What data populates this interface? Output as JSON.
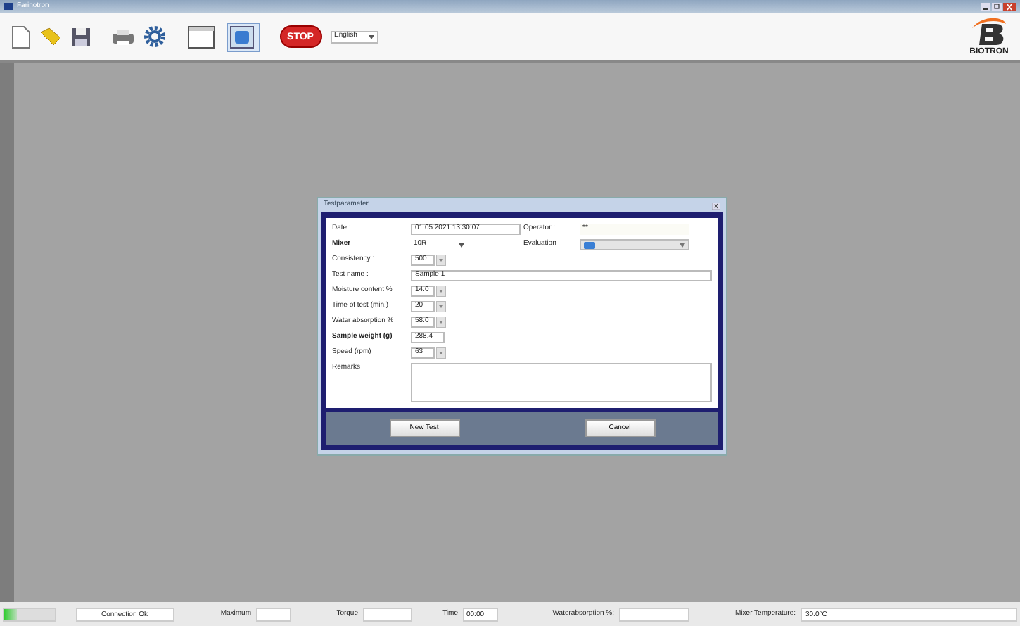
{
  "window": {
    "title": "Farinotron"
  },
  "toolbar": {
    "views": [
      {
        "selected": false
      },
      {
        "selected": true
      }
    ],
    "stop": "STOP",
    "language": "English",
    "logo": "BIOTRON"
  },
  "dialog": {
    "title": "Testparameter",
    "fields": [
      {
        "kind": "text",
        "label": "Date :",
        "value": "01.05.2021 13:30:07"
      },
      {
        "kind": "select",
        "label": "Mixer",
        "value": "10R"
      },
      {
        "kind": "spin",
        "label": "Consistency :",
        "value": "500"
      },
      {
        "kind": "wide",
        "label": "Test name :",
        "value": "Sample 1"
      },
      {
        "kind": "spin",
        "label": "Moisture content %",
        "value": "14.0"
      },
      {
        "kind": "spin",
        "label": "Time of test (min.)",
        "value": "20"
      },
      {
        "kind": "spin",
        "label": "Water absorption %",
        "value": "58.0"
      },
      {
        "kind": "text",
        "label": "Sample weight (g)",
        "value": "288.4"
      },
      {
        "kind": "spin",
        "label": "Speed (rpm)",
        "value": "63"
      },
      {
        "kind": "area",
        "label": "Remarks"
      }
    ],
    "operator": {
      "label": "Operator :",
      "value": "**"
    },
    "evaluation": {
      "label": "Evaluation"
    },
    "buttons": [
      "New Test",
      "Cancel"
    ]
  },
  "status_bar": {
    "level": 0.25,
    "connection": "Connection Ok",
    "maximum": "Maximum",
    "torque": "Torque",
    "time_label": "Time",
    "time": "00:00",
    "water_label": "Waterabsorption %:",
    "temp_label": "Mixer Temperature:",
    "temp": "30.0°C"
  }
}
